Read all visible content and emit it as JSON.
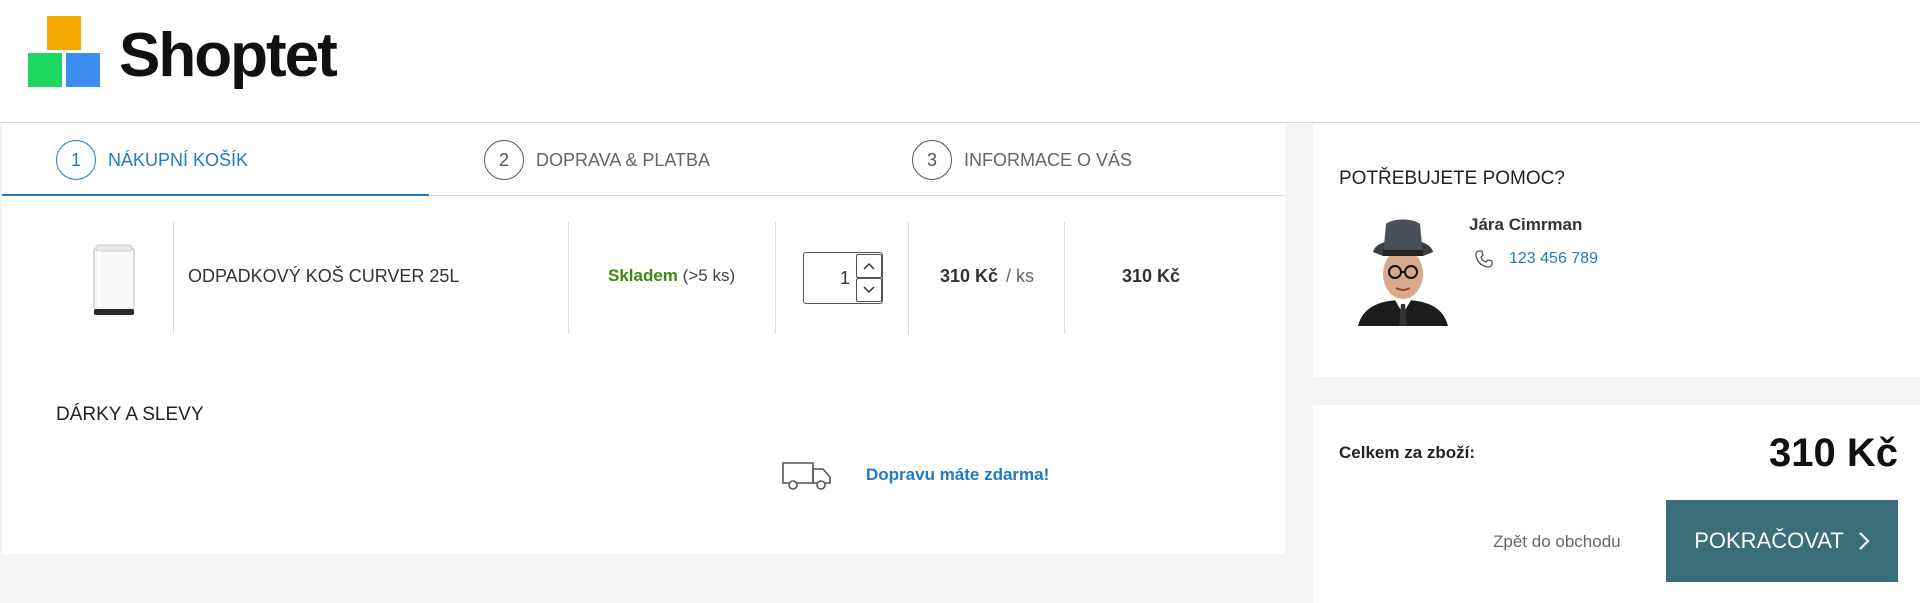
{
  "brand": {
    "name": "Shoptet"
  },
  "steps": [
    {
      "number": "1",
      "label": "NÁKUPNÍ KOŠÍK"
    },
    {
      "number": "2",
      "label": "DOPRAVA & PLATBA"
    },
    {
      "number": "3",
      "label": "INFORMACE O VÁS"
    }
  ],
  "cart": {
    "item": {
      "name": "ODPADKOVÝ KOŠ CURVER 25L",
      "stock_status": "Skladem",
      "stock_count": "(>5 ks)",
      "quantity": "1",
      "unit_price": "310 Kč",
      "unit_suffix": "/ ks",
      "total": "310 Kč"
    }
  },
  "gifts": {
    "title": "DÁRKY A SLEVY"
  },
  "shipping": {
    "message": "Dopravu máte zdarma!"
  },
  "help": {
    "title": "POTŘEBUJETE POMOC?",
    "contact_name": "Jára Cimrman",
    "phone": "123 456 789"
  },
  "summary": {
    "label": "Celkem za zboží:",
    "total": "310 Kč",
    "back_label": "Zpět do obchodu",
    "continue_label": "POKRAČOVAT",
    "continue_icon": "chevron-right-icon"
  },
  "colors": {
    "accent": "#1f7bc4",
    "stock_green": "#3a8a12",
    "button": "#3a6e7a"
  }
}
